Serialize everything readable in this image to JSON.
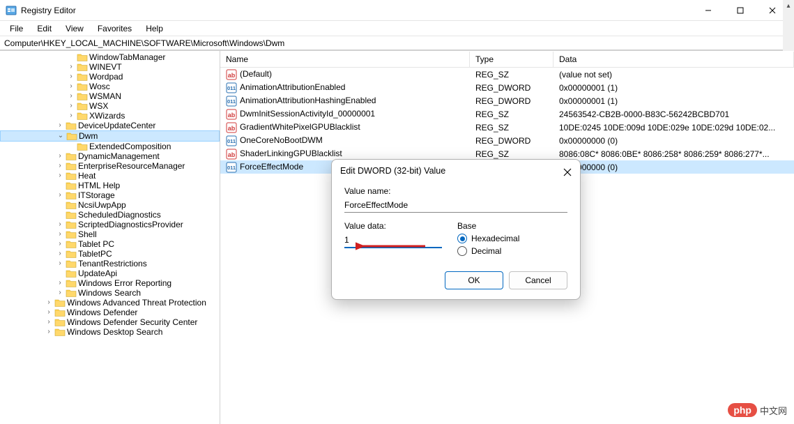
{
  "window": {
    "title": "Registry Editor"
  },
  "menubar": {
    "file": "File",
    "edit": "Edit",
    "view": "View",
    "favorites": "Favorites",
    "help": "Help"
  },
  "addressbar": {
    "path": "Computer\\HKEY_LOCAL_MACHINE\\SOFTWARE\\Microsoft\\Windows\\Dwm"
  },
  "tree": {
    "items": [
      {
        "label": "WindowTabManager",
        "indent": 6,
        "chevron": "",
        "selected": false
      },
      {
        "label": "WINEVT",
        "indent": 6,
        "chevron": ">",
        "selected": false
      },
      {
        "label": "Wordpad",
        "indent": 6,
        "chevron": ">",
        "selected": false
      },
      {
        "label": "Wosc",
        "indent": 6,
        "chevron": ">",
        "selected": false
      },
      {
        "label": "WSMAN",
        "indent": 6,
        "chevron": ">",
        "selected": false
      },
      {
        "label": "WSX",
        "indent": 6,
        "chevron": ">",
        "selected": false
      },
      {
        "label": "XWizards",
        "indent": 6,
        "chevron": ">",
        "selected": false
      },
      {
        "label": "DeviceUpdateCenter",
        "indent": 5,
        "chevron": ">",
        "selected": false
      },
      {
        "label": "Dwm",
        "indent": 5,
        "chevron": "v",
        "selected": true
      },
      {
        "label": "ExtendedComposition",
        "indent": 6,
        "chevron": "",
        "selected": false
      },
      {
        "label": "DynamicManagement",
        "indent": 5,
        "chevron": ">",
        "selected": false
      },
      {
        "label": "EnterpriseResourceManager",
        "indent": 5,
        "chevron": ">",
        "selected": false
      },
      {
        "label": "Heat",
        "indent": 5,
        "chevron": ">",
        "selected": false
      },
      {
        "label": "HTML Help",
        "indent": 5,
        "chevron": "",
        "selected": false
      },
      {
        "label": "ITStorage",
        "indent": 5,
        "chevron": ">",
        "selected": false
      },
      {
        "label": "NcsiUwpApp",
        "indent": 5,
        "chevron": "",
        "selected": false
      },
      {
        "label": "ScheduledDiagnostics",
        "indent": 5,
        "chevron": "",
        "selected": false
      },
      {
        "label": "ScriptedDiagnosticsProvider",
        "indent": 5,
        "chevron": ">",
        "selected": false
      },
      {
        "label": "Shell",
        "indent": 5,
        "chevron": ">",
        "selected": false
      },
      {
        "label": "Tablet PC",
        "indent": 5,
        "chevron": ">",
        "selected": false
      },
      {
        "label": "TabletPC",
        "indent": 5,
        "chevron": ">",
        "selected": false
      },
      {
        "label": "TenantRestrictions",
        "indent": 5,
        "chevron": ">",
        "selected": false
      },
      {
        "label": "UpdateApi",
        "indent": 5,
        "chevron": "",
        "selected": false
      },
      {
        "label": "Windows Error Reporting",
        "indent": 5,
        "chevron": ">",
        "selected": false
      },
      {
        "label": "Windows Search",
        "indent": 5,
        "chevron": ">",
        "selected": false
      },
      {
        "label": "Windows Advanced Threat Protection",
        "indent": 4,
        "chevron": ">",
        "selected": false
      },
      {
        "label": "Windows Defender",
        "indent": 4,
        "chevron": ">",
        "selected": false
      },
      {
        "label": "Windows Defender Security Center",
        "indent": 4,
        "chevron": ">",
        "selected": false
      },
      {
        "label": "Windows Desktop Search",
        "indent": 4,
        "chevron": ">",
        "selected": false
      }
    ]
  },
  "list": {
    "headers": {
      "name": "Name",
      "type": "Type",
      "data": "Data"
    },
    "rows": [
      {
        "icon": "sz",
        "name": "(Default)",
        "type": "REG_SZ",
        "data": "(value not set)"
      },
      {
        "icon": "dw",
        "name": "AnimationAttributionEnabled",
        "type": "REG_DWORD",
        "data": "0x00000001 (1)"
      },
      {
        "icon": "dw",
        "name": "AnimationAttributionHashingEnabled",
        "type": "REG_DWORD",
        "data": "0x00000001 (1)"
      },
      {
        "icon": "sz",
        "name": "DwmInitSessionActivityId_00000001",
        "type": "REG_SZ",
        "data": "24563542-CB2B-0000-B83C-56242BCBD701"
      },
      {
        "icon": "sz",
        "name": "GradientWhitePixelGPUBlacklist",
        "type": "REG_SZ",
        "data": "10DE:0245 10DE:009d 10DE:029e 10DE:029d 10DE:02..."
      },
      {
        "icon": "dw",
        "name": "OneCoreNoBootDWM",
        "type": "REG_DWORD",
        "data": "0x00000000 (0)"
      },
      {
        "icon": "sz",
        "name": "ShaderLinkingGPUBlacklist",
        "type": "REG_SZ",
        "data": "8086:08C* 8086:0BE* 8086:258* 8086:259* 8086:277*..."
      },
      {
        "icon": "dw",
        "name": "ForceEffectMode",
        "type": "",
        "data": "0x00000000 (0)",
        "selected": true
      }
    ]
  },
  "dialog": {
    "title": "Edit DWORD (32-bit) Value",
    "value_name_label": "Value name:",
    "value_name": "ForceEffectMode",
    "value_data_label": "Value data:",
    "value_data": "1",
    "base_label": "Base",
    "hex_label": "Hexadecimal",
    "dec_label": "Decimal",
    "ok": "OK",
    "cancel": "Cancel"
  },
  "watermark": {
    "badge": "php",
    "text": "中文网"
  }
}
